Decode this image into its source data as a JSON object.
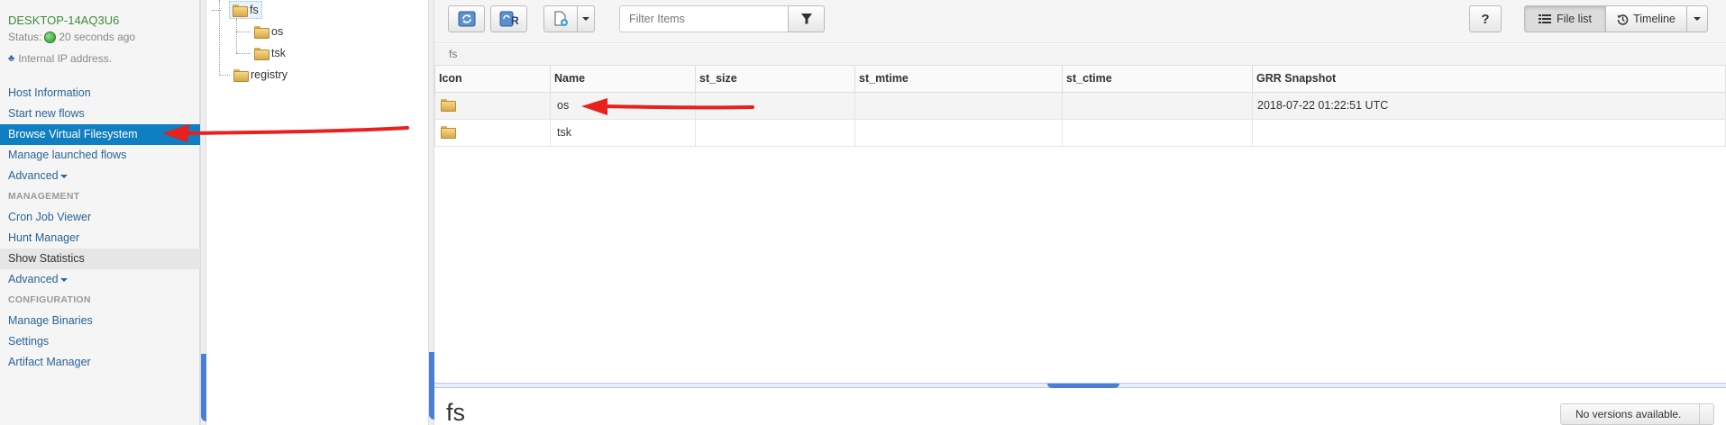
{
  "host": {
    "name": "DESKTOP-14AQ3U6",
    "status_label": "Status:",
    "status_time": "20 seconds ago",
    "ip_text": "Internal IP address."
  },
  "nav": {
    "items": [
      {
        "label": "Host Information",
        "kind": "link"
      },
      {
        "label": "Start new flows",
        "kind": "link"
      },
      {
        "label": "Browse Virtual Filesystem",
        "kind": "active"
      },
      {
        "label": "Manage launched flows",
        "kind": "link"
      },
      {
        "label": "Advanced",
        "kind": "dropdown"
      },
      {
        "label": "MANAGEMENT",
        "kind": "section"
      },
      {
        "label": "Cron Job Viewer",
        "kind": "link"
      },
      {
        "label": "Hunt Manager",
        "kind": "link"
      },
      {
        "label": "Show Statistics",
        "kind": "hover"
      },
      {
        "label": "Advanced",
        "kind": "dropdown"
      },
      {
        "label": "CONFIGURATION",
        "kind": "section"
      },
      {
        "label": "Manage Binaries",
        "kind": "link"
      },
      {
        "label": "Settings",
        "kind": "link"
      },
      {
        "label": "Artifact Manager",
        "kind": "link"
      }
    ]
  },
  "tree": {
    "root": "fs",
    "children": [
      "os",
      "tsk"
    ],
    "sibling": "registry"
  },
  "toolbar": {
    "filter_placeholder": "Filter Items",
    "help_label": "?",
    "file_list_label": "File list",
    "timeline_label": "Timeline"
  },
  "breadcrumb": "fs",
  "table": {
    "columns": [
      "Icon",
      "Name",
      "st_size",
      "st_mtime",
      "st_ctime",
      "GRR Snapshot"
    ],
    "rows": [
      {
        "name": "os",
        "st_size": "",
        "st_mtime": "",
        "st_ctime": "",
        "snapshot": "2018-07-22 01:22:51 UTC"
      },
      {
        "name": "tsk",
        "st_size": "",
        "st_mtime": "",
        "st_ctime": "",
        "snapshot": ""
      }
    ]
  },
  "details": {
    "title": "fs",
    "versions": "No versions available."
  },
  "colors": {
    "accent": "#0f7fc1",
    "annotation_arrow": "#e8201e"
  }
}
